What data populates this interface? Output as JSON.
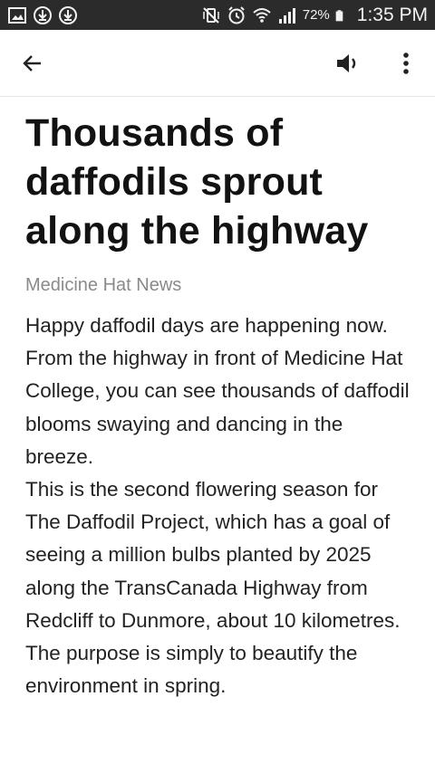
{
  "status_bar": {
    "left_icons": [
      "gallery-icon",
      "download-icon",
      "download-icon"
    ],
    "battery_percent": "72%",
    "time": "1:35 PM"
  },
  "toolbar": {
    "back_icon": "arrow-left-icon",
    "speaker_icon": "volume-icon",
    "more_icon": "more-vertical-icon"
  },
  "article": {
    "headline": "Thousands of daffodils sprout along the highway",
    "source": "Medicine Hat News",
    "paragraphs": [
      "Happy daffodil days are happening now.",
      "From the highway in front of Medicine Hat College, you can see thousands of daffodil blooms swaying and dancing in the breeze.",
      "This is the second flowering season for The Daffodil Project, which has a goal of seeing a million bulbs planted by 2025 along the TransCanada Highway from Redcliff to Dunmore, about 10 kilometres. The purpose is simply to beautify the environment in spring."
    ]
  },
  "colors": {
    "status_bar_bg": "#2b2b2b",
    "source_text": "#8a8a8a"
  }
}
